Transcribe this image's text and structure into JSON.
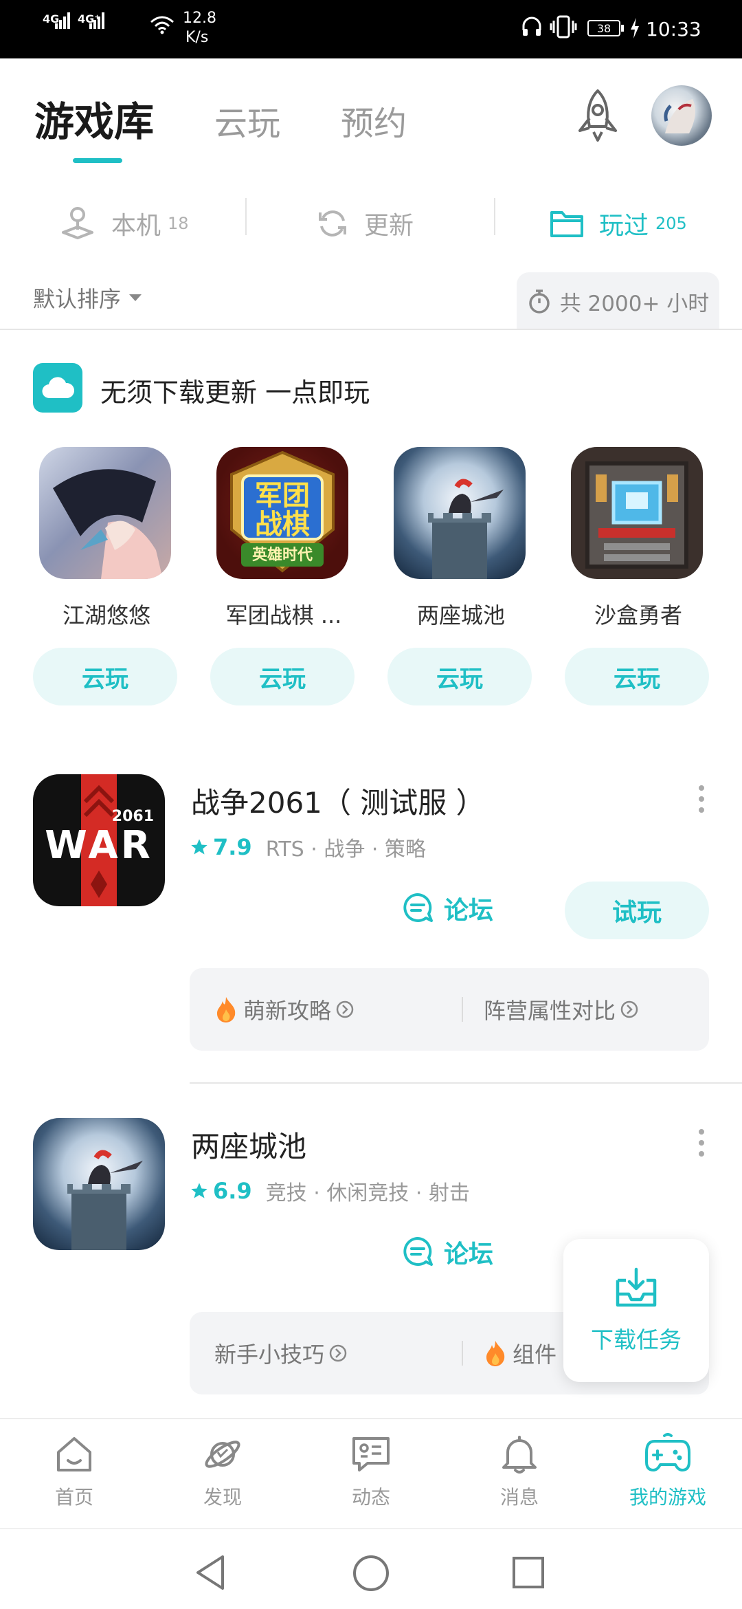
{
  "status_bar": {
    "network_left": "4G",
    "network_right": "4G⁺",
    "speed_value": "12.8",
    "speed_unit": "K/s",
    "battery": "38",
    "time": "10:33"
  },
  "top_tabs": [
    {
      "label": "游戏库",
      "active": true
    },
    {
      "label": "云玩",
      "active": false
    },
    {
      "label": "预约",
      "active": false
    }
  ],
  "sub_tabs": [
    {
      "label": "本机",
      "count": "18",
      "icon": "joystick-icon"
    },
    {
      "label": "更新",
      "count": "",
      "icon": "refresh-icon"
    },
    {
      "label": "玩过",
      "count": "205",
      "icon": "folder-icon",
      "active": true
    }
  ],
  "sort": {
    "label": "默认排序"
  },
  "total_hours": "共 2000+ 小时",
  "cloud_section": {
    "title": "无须下载更新 一点即玩",
    "games": [
      {
        "name": "江湖悠悠",
        "button": "云玩"
      },
      {
        "name": "军团战棋 ...",
        "button": "云玩",
        "badge_line1": "军团",
        "badge_line2": "战棋",
        "ribbon": "英雄时代"
      },
      {
        "name": "两座城池",
        "button": "云玩"
      },
      {
        "name": "沙盒勇者",
        "button": "云玩"
      }
    ]
  },
  "entries": [
    {
      "title": "战争2061（ 测试服 ）",
      "rating": "7.9",
      "tags": "RTS · 战争 · 策略",
      "forum": "论坛",
      "action": "试玩",
      "icon_text": "WAR",
      "icon_year": "2061",
      "guides": [
        "萌新攻略",
        "阵营属性对比"
      ]
    },
    {
      "title": "两座城池",
      "rating": "6.9",
      "tags": "竞技 · 休闲竞技 · 射击",
      "forum": "论坛",
      "guides": [
        "新手小技巧",
        "组件"
      ]
    }
  ],
  "download_task": {
    "label": "下载任务"
  },
  "bottom_nav": [
    {
      "label": "首页",
      "icon": "home-icon"
    },
    {
      "label": "发现",
      "icon": "planet-icon"
    },
    {
      "label": "动态",
      "icon": "message-icon"
    },
    {
      "label": "消息",
      "icon": "bell-icon"
    },
    {
      "label": "我的游戏",
      "icon": "gamepad-icon",
      "active": true
    }
  ],
  "colors": {
    "accent": "#1fbfc5",
    "text": "#222222",
    "muted": "#999999"
  }
}
